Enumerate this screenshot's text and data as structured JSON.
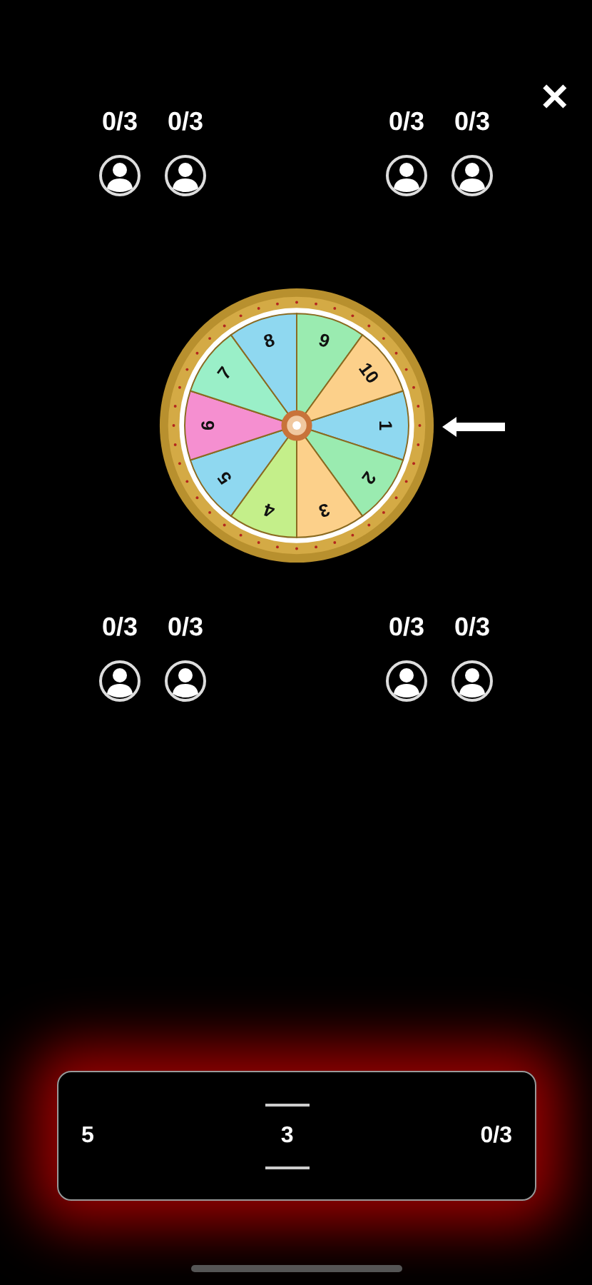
{
  "close_button": {
    "label": "✕"
  },
  "top_groups": [
    {
      "players": [
        {
          "score": "0/3"
        },
        {
          "score": "0/3"
        }
      ]
    },
    {
      "players": [
        {
          "score": "0/3"
        },
        {
          "score": "0/3"
        }
      ]
    }
  ],
  "wheel": {
    "segments": [
      {
        "label": "1",
        "color": "#8fd8f0"
      },
      {
        "label": "2",
        "color": "#9aebb0"
      },
      {
        "label": "3",
        "color": "#fcd08a"
      },
      {
        "label": "4",
        "color": "#c4ef8a"
      },
      {
        "label": "5",
        "color": "#8fd8f0"
      },
      {
        "label": "6",
        "color": "#f58fd0"
      },
      {
        "label": "7",
        "color": "#9aefc8"
      },
      {
        "label": "8",
        "color": "#8fd8f0"
      },
      {
        "label": "9",
        "color": "#9aebb0"
      },
      {
        "label": "10",
        "color": "#fcd08a"
      }
    ]
  },
  "bottom_groups": [
    {
      "players": [
        {
          "score": "0/3"
        },
        {
          "score": "0/3"
        }
      ]
    },
    {
      "players": [
        {
          "score": "0/3"
        },
        {
          "score": "0/3"
        }
      ]
    }
  ],
  "bet_panel": {
    "left_value": "5",
    "center_value": "3",
    "right_value": "0/3"
  }
}
